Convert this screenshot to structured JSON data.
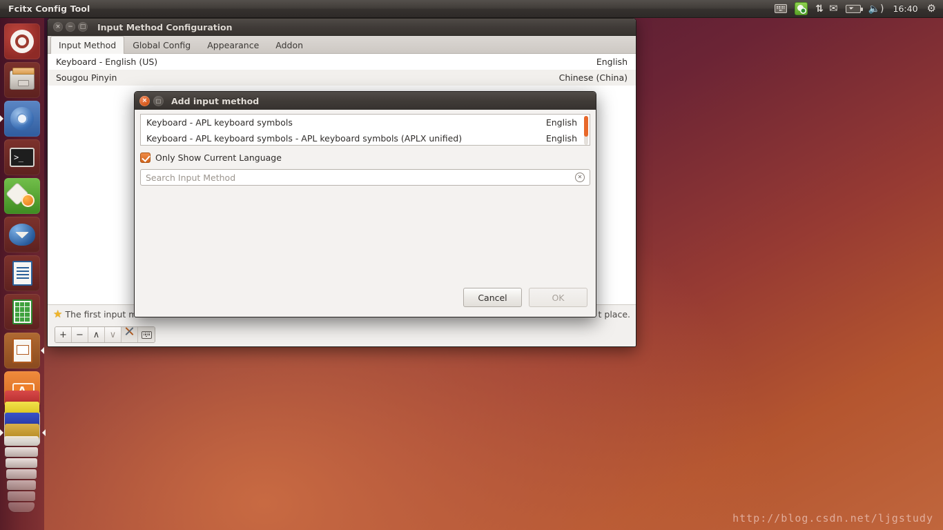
{
  "panel": {
    "title": "Fcitx Config Tool",
    "tray": [
      {
        "name": "keyboard-indicator-icon",
        "label": ""
      },
      {
        "name": "fcitx-indicator-icon",
        "label": ""
      },
      {
        "name": "network-updown-icon",
        "label": "⇅"
      },
      {
        "name": "mail-icon",
        "label": "✉"
      },
      {
        "name": "battery-icon",
        "label": ""
      },
      {
        "name": "volume-icon",
        "label": "🔊"
      },
      {
        "name": "clock",
        "label": "16:40"
      },
      {
        "name": "session-gear-icon",
        "label": "⚙"
      }
    ],
    "clock": "16:40"
  },
  "launcher": {
    "items": [
      {
        "name": "dash-home",
        "label": "Ubuntu Dash Home"
      },
      {
        "name": "files",
        "label": "Files"
      },
      {
        "name": "chromium",
        "label": "Chromium Web Browser"
      },
      {
        "name": "terminal",
        "label": "Terminal"
      },
      {
        "name": "software-updater",
        "label": "Software Updater"
      },
      {
        "name": "thunderbird",
        "label": "Thunderbird Mail"
      },
      {
        "name": "libreoffice-writer",
        "label": "LibreOffice Writer"
      },
      {
        "name": "libreoffice-calc",
        "label": "LibreOffice Calc"
      },
      {
        "name": "libreoffice-impress",
        "label": "LibreOffice Impress"
      },
      {
        "name": "ubuntu-software-center",
        "label": "Ubuntu Software Center"
      },
      {
        "name": "amazon",
        "label": "Amazon"
      }
    ]
  },
  "main_window": {
    "title": "Input Method Configuration",
    "window_buttons": {
      "close": "×",
      "minimize": "−",
      "maximize": "□"
    },
    "tabs": [
      {
        "label": "Input Method",
        "active": true
      },
      {
        "label": "Global Config",
        "active": false
      },
      {
        "label": "Appearance",
        "active": false
      },
      {
        "label": "Addon",
        "active": false
      }
    ],
    "input_methods": [
      {
        "name": "Keyboard - English (US)",
        "language": "English"
      },
      {
        "name": "Sougou Pinyin",
        "language": "Chinese (China)"
      }
    ],
    "hint": {
      "icon": "star-icon",
      "text_start": "The first input m",
      "text_end": "t place.",
      "full_text": "The first input method will be inactive state usually, please make sure you use a keyboard layout in the first place."
    },
    "toolbar": [
      {
        "name": "add-button",
        "label": "+",
        "state": "enabled"
      },
      {
        "name": "remove-button",
        "label": "−",
        "state": "enabled"
      },
      {
        "name": "move-up-button",
        "label": "∧",
        "state": "enabled"
      },
      {
        "name": "move-down-button",
        "label": "∨",
        "state": "dim"
      },
      {
        "name": "configure-button",
        "label": "",
        "state": "pressed"
      },
      {
        "name": "keyboard-layout-button",
        "label": "",
        "state": "enabled"
      }
    ]
  },
  "add_dialog": {
    "title": "Add input method",
    "window_buttons": {
      "close": "×",
      "maximize": "□"
    },
    "rows": [
      {
        "name": "Keyboard - APL keyboard symbols",
        "language": "English"
      },
      {
        "name": "Keyboard - APL keyboard symbols - APL keyboard symbols (APLX unified)",
        "language": "English"
      }
    ],
    "checkbox": {
      "label": "Only Show Current Language",
      "checked": true
    },
    "search": {
      "value": "",
      "placeholder": "Search Input Method",
      "clear_icon": "✕"
    },
    "buttons": [
      {
        "name": "cancel-button",
        "label": "Cancel",
        "disabled": false
      },
      {
        "name": "ok-button",
        "label": "OK",
        "disabled": true
      }
    ]
  },
  "watermark": {
    "text": "http://blog.csdn.net/ljgstudy"
  },
  "colors": {
    "accent_orange": "#e8682a",
    "panel_bg": "#3a3633",
    "launcher_bg": "#5c1a28",
    "desktop_top": "#3a1230",
    "desktop_bottom": "#c0663d"
  }
}
